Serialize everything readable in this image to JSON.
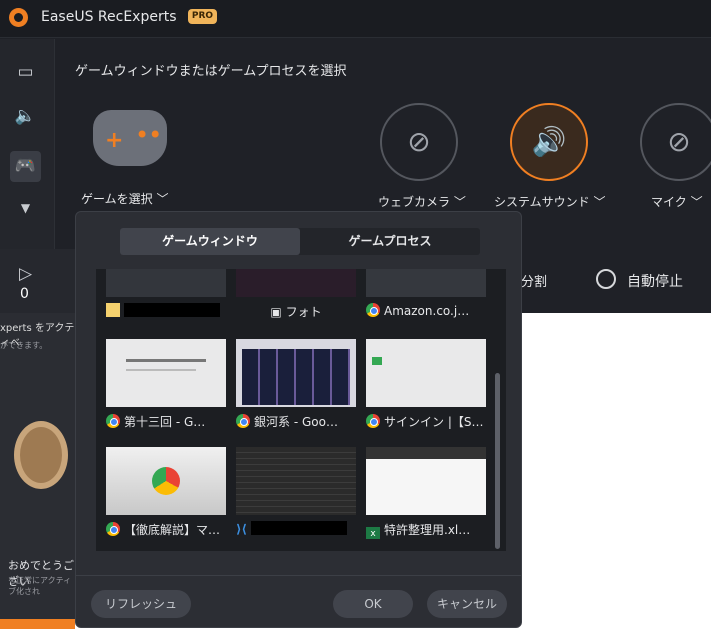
{
  "app": {
    "title": "EaseUS RecExperts",
    "badge": "PRO"
  },
  "sidebar": {
    "count": "0"
  },
  "main": {
    "header": "ゲームウィンドウまたはゲームプロセスを選択",
    "game_select": "ゲームを選択 ﹀",
    "webcam": "ウェブカメラ ﹀",
    "system_sound": "システムサウンド ﹀",
    "mic": "マイク ﹀",
    "split": "分割",
    "auto_stop": "自動停止"
  },
  "promo": {
    "text": "xperts をアクティベ",
    "text2": "ができます。",
    "congrats": "おめでとうござい",
    "sub": "を正常にアクティブ化され"
  },
  "dialog": {
    "tab_window": "ゲームウィンドウ",
    "tab_process": "ゲームプロセス",
    "items": [
      {
        "caption": ""
      },
      {
        "caption": "フォト"
      },
      {
        "caption": "Amazon.co.j…"
      },
      {
        "caption": "第十三回 - G…"
      },
      {
        "caption": "銀河系 - Goo…"
      },
      {
        "caption": "サインイン |【S…"
      },
      {
        "caption": "【徹底解説】マ…"
      },
      {
        "caption": ""
      },
      {
        "caption": "特許整理用.xl…"
      }
    ],
    "refresh": "リフレッシュ",
    "ok": "OK",
    "cancel": "キャンセル"
  }
}
